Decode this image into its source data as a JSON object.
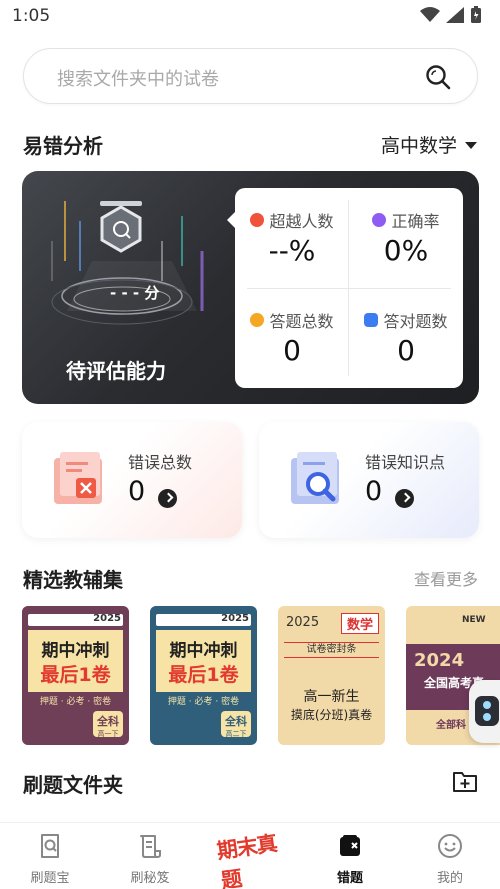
{
  "status_bar": {
    "time": "1:05"
  },
  "search": {
    "placeholder": "搜索文件夹中的试卷"
  },
  "analysis": {
    "title": "易错分析",
    "subject": "高中数学",
    "score_text": "- - - 分",
    "ability_label": "待评估能力",
    "stats": [
      {
        "label": "超越人数",
        "value": "--%",
        "icon": "rank-icon",
        "color": "#f0523b"
      },
      {
        "label": "正确率",
        "value": "0%",
        "icon": "accuracy-icon",
        "color": "#8e5cf2"
      },
      {
        "label": "答题总数",
        "value": "0",
        "icon": "medal-icon",
        "color": "#f5a623"
      },
      {
        "label": "答对题数",
        "value": "0",
        "icon": "check-icon",
        "color": "#3b7cf0"
      }
    ]
  },
  "error_cards": [
    {
      "label": "错误总数",
      "value": "0",
      "icon": "error-doc-icon"
    },
    {
      "label": "错误知识点",
      "value": "0",
      "icon": "search-doc-icon"
    }
  ],
  "materials": {
    "title": "精选教辅集",
    "see_more": "查看更多",
    "books": [
      {
        "year": "2025",
        "title_line1": "期中冲刺",
        "title_line2": "最后1卷",
        "tags": "押题 · 必考 · 密卷",
        "badge": "全科",
        "badge_sub": "高一下",
        "bg": "#6e3f57"
      },
      {
        "year": "2025",
        "title_line1": "期中冲刺",
        "title_line2": "最后1卷",
        "tags": "押题 · 必考 · 密卷",
        "badge": "全科",
        "badge_sub": "高二下",
        "bg": "#2f5f7a"
      },
      {
        "year": "2025",
        "tag": "数学",
        "seal": "试卷密封条",
        "title_line1": "高一新生",
        "title_line2": "摸底(分班)真卷",
        "bg": "#f2d9a8"
      },
      {
        "tag": "NEW",
        "year": "2024",
        "title_line1": "全国高考真",
        "badge": "全部科",
        "bg": "#6d3a5a"
      }
    ]
  },
  "folder": {
    "title": "刷题文件夹"
  },
  "nav": [
    {
      "label": "刷题宝",
      "icon": "search-doc-icon",
      "active": false
    },
    {
      "label": "刷秘笈",
      "icon": "scroll-icon",
      "active": false
    },
    {
      "label": "期末真题",
      "icon": "promo-badge-icon",
      "active": false
    },
    {
      "label": "错题",
      "icon": "wrong-book-icon",
      "active": true
    },
    {
      "label": "我的",
      "icon": "smile-icon",
      "active": false
    }
  ],
  "colors": {
    "accent": "#e23b2e",
    "dark_card": "#2a2c30"
  }
}
